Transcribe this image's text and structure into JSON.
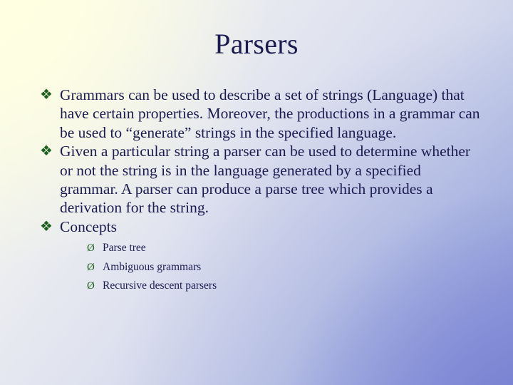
{
  "slide": {
    "title": "Parsers",
    "bullet_glyph": "❖",
    "sub_bullet_glyph": "Ø",
    "accent_color": "#1f5f1f",
    "text_color": "#1b1b4f",
    "bullets": [
      "Grammars can be used to describe a set of strings (Language) that have certain properties.  Moreover, the productions in a grammar can be used to “generate” strings in the specified language.",
      "Given a particular string a parser can be used to determine whether or not the string is in the language generated by a specified grammar.  A parser can produce a parse tree which provides a derivation for the string.",
      "Concepts"
    ],
    "sub_bullets": [
      "Parse tree",
      "Ambiguous grammars",
      "Recursive descent parsers"
    ]
  }
}
